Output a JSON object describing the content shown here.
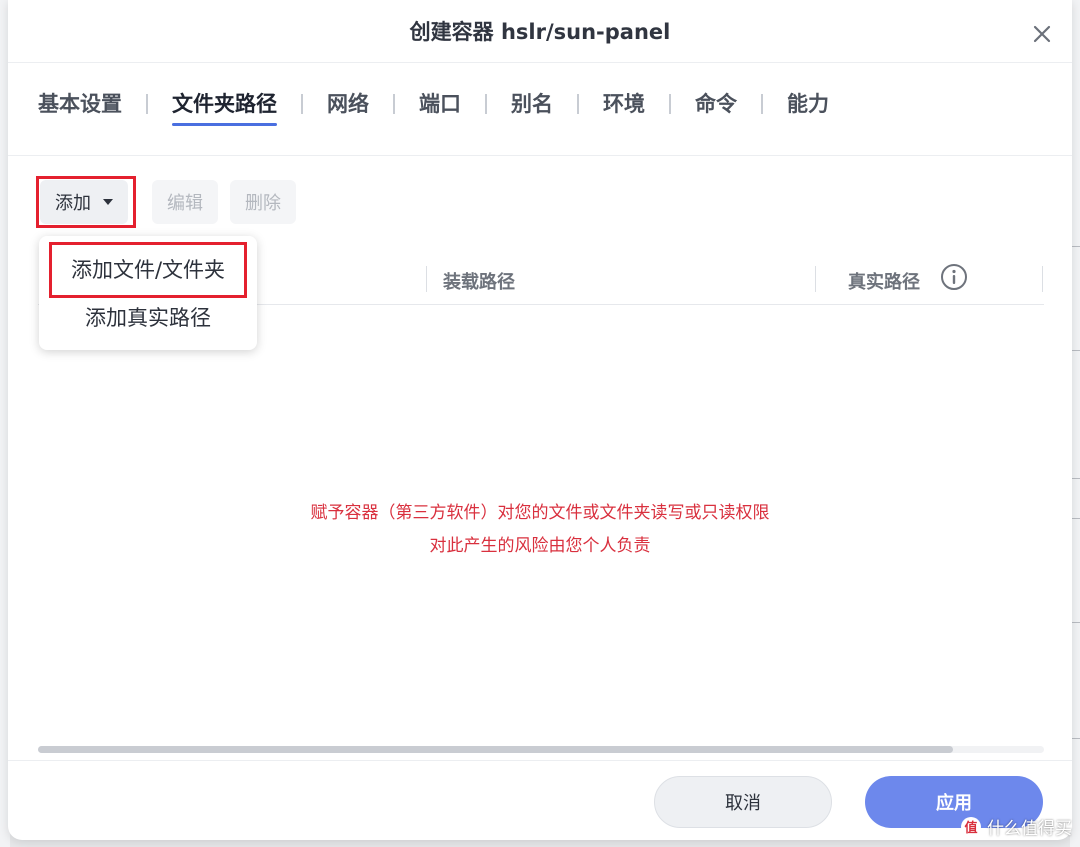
{
  "dialog": {
    "title": "创建容器 hslr/sun-panel"
  },
  "tabs": [
    {
      "label": "基本设置",
      "active": false
    },
    {
      "label": "文件夹路径",
      "active": true
    },
    {
      "label": "网络",
      "active": false
    },
    {
      "label": "端口",
      "active": false
    },
    {
      "label": "别名",
      "active": false
    },
    {
      "label": "环境",
      "active": false
    },
    {
      "label": "命令",
      "active": false
    },
    {
      "label": "能力",
      "active": false
    }
  ],
  "toolbar": {
    "add_label": "添加",
    "edit_label": "编辑",
    "delete_label": "删除"
  },
  "dropdown": {
    "items": [
      "添加文件/文件夹",
      "添加真实路径"
    ]
  },
  "table": {
    "columns": [
      "装载路径",
      "真实路径"
    ]
  },
  "notice": {
    "line1": "赋予容器（第三方软件）对您的文件或文件夹读写或只读权限",
    "line2": "对此产生的风险由您个人负责"
  },
  "scroll": {
    "position": 0.91
  },
  "footer": {
    "cancel_label": "取消",
    "apply_label": "应用"
  },
  "watermark": {
    "badge": "值",
    "text": "什么值得买"
  },
  "colors": {
    "accent": "#4a6fe0",
    "apply": "#6d88ec",
    "highlight": "#e4202e",
    "notice": "#d9303e"
  }
}
